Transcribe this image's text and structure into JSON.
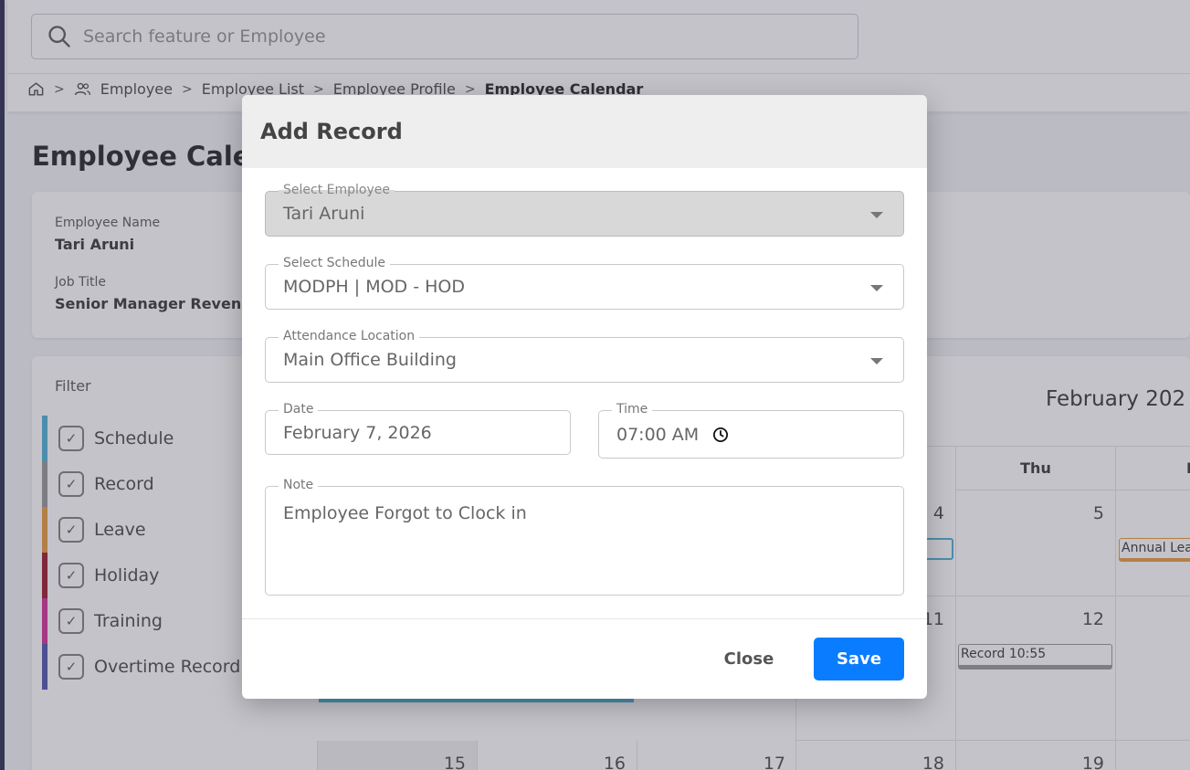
{
  "search": {
    "placeholder": "Search feature or Employee"
  },
  "breadcrumb": {
    "items": [
      "Employee",
      "Employee List",
      "Employee Profile"
    ],
    "current": "Employee Calendar"
  },
  "page": {
    "title": "Employee Calen"
  },
  "employee": {
    "name_label": "Employee Name",
    "name": "Tari Aruni",
    "job_label": "Job Title",
    "job": "Senior Manager Revenu"
  },
  "filter": {
    "title": "Filter",
    "items": [
      {
        "label": "Schedule",
        "color": "#5ab4d6"
      },
      {
        "label": "Record",
        "color": "#9e9e9e"
      },
      {
        "label": "Leave",
        "color": "#e8a34a"
      },
      {
        "label": "Holiday",
        "color": "#a3283a"
      },
      {
        "label": "Training",
        "color": "#d63fa0"
      },
      {
        "label": "Overtime Record",
        "color": "#5c5fb0"
      }
    ]
  },
  "calendar": {
    "month": "February 202",
    "headers": {
      "thu": "Thu",
      "fri": "F"
    },
    "days": [
      "4",
      "5",
      "11",
      "12",
      "15",
      "16",
      "17",
      "18",
      "19"
    ],
    "events": {
      "record": "Record 10:55",
      "leave": "Annual Lea"
    }
  },
  "dialog": {
    "title": "Add Record",
    "employee": {
      "label": "Select Employee",
      "value": "Tari Aruni"
    },
    "schedule": {
      "label": "Select Schedule",
      "value": "MODPH | MOD - HOD"
    },
    "location": {
      "label": "Attendance Location",
      "value": "Main Office Building"
    },
    "date": {
      "label": "Date",
      "value": "February 7, 2026"
    },
    "time": {
      "label": "Time",
      "value": "07:00 AM"
    },
    "note": {
      "label": "Note",
      "value": "Employee Forgot to Clock in"
    },
    "close_label": "Close",
    "save_label": "Save"
  }
}
